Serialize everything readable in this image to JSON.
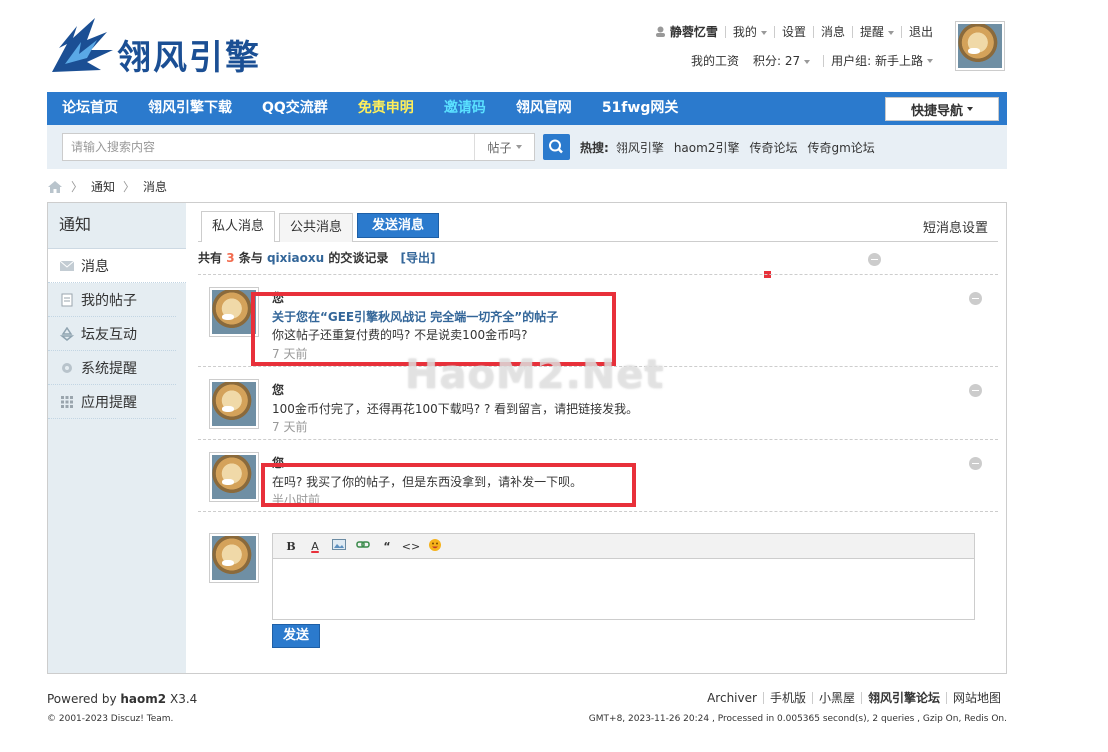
{
  "header": {
    "logo_text": "翎风引擎",
    "user": {
      "name": "静蓉忆雪",
      "links": [
        "我的",
        "设置",
        "消息",
        "提醒",
        "退出"
      ],
      "wage": "我的工资",
      "credits": "积分: 27",
      "group": "用户组: 新手上路"
    }
  },
  "nav": {
    "items": [
      "论坛首页",
      "翎风引擎下载",
      "QQ交流群",
      "免责申明",
      "邀请码",
      "翎风官网",
      "51fwg网关"
    ],
    "quick": "快捷导航",
    "colors": {
      "bar": "#2b7acd",
      "yellow_item": "#ffef5a",
      "cyan_item": "#5ae0ff"
    }
  },
  "search": {
    "placeholder": "请输入搜索内容",
    "scope": "帖子",
    "hot_label": "热搜:",
    "hot": [
      "翎风引擎",
      "haom2引擎",
      "传奇论坛",
      "传奇gm论坛"
    ]
  },
  "breadcrumb": [
    "通知",
    "消息"
  ],
  "sidebar": {
    "title": "通知",
    "items": [
      "消息",
      "我的帖子",
      "坛友互动",
      "系统提醒",
      "应用提醒"
    ]
  },
  "tabs": {
    "private": "私人消息",
    "public": "公共消息",
    "send": "发送消息",
    "settings": "短消息设置"
  },
  "summary": {
    "prefix": "共有",
    "count": "3",
    "middle": "条与",
    "user": "qixiaoxu",
    "suffix": "的交谈记录",
    "export": "[导出]"
  },
  "messages": [
    {
      "author": "您",
      "title": "关于您在“GEE引擎秋风战记 完全端一切齐全”的帖子",
      "text": "你这帖子还重复付费的吗? 不是说卖100金币吗?",
      "time": "7 天前"
    },
    {
      "author": "您",
      "title": "",
      "text": "100金币付完了，还得再花100下载吗? ? 看到留言，请把链接发我。",
      "time": "7 天前"
    },
    {
      "author": "您",
      "title": "",
      "text": "在吗? 我买了你的帖子，但是东西没拿到，请补发一下呗。",
      "time": "半小时前"
    }
  ],
  "editor": {
    "tools": [
      "B",
      "A",
      "img",
      "link",
      "“",
      "<>",
      "☺"
    ],
    "send": "发送"
  },
  "watermark": "HaoM2.Net",
  "footer": {
    "powered_prefix": "Powered by",
    "powered_name": "haom2",
    "version": "X3.4",
    "copyright": "© 2001-2023 Discuz! Team.",
    "links": [
      "Archiver",
      "手机版",
      "小黑屋",
      "翎风引擎论坛",
      "网站地图"
    ],
    "stats": "GMT+8, 2023-11-26 20:24 , Processed in 0.005365 second(s), 2 queries , Gzip On, Redis On."
  }
}
